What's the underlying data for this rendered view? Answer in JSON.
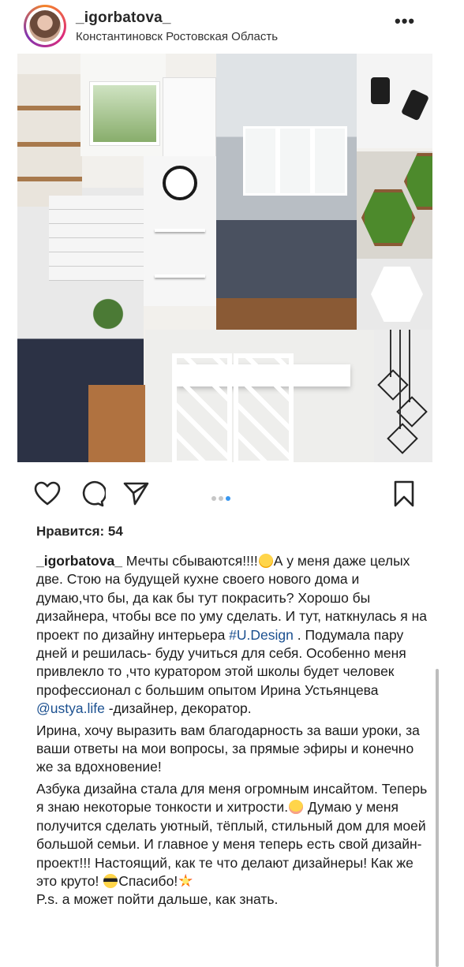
{
  "header": {
    "username": "_igorbatova_",
    "location": "Константиновск Ростовская Область",
    "more_icon": "more-dots-icon"
  },
  "post_image": {
    "description_icon": "kitchen-moodboard-collage"
  },
  "actions": {
    "like_icon": "heart-icon",
    "comment_icon": "comment-icon",
    "share_icon": "paper-plane-icon",
    "save_icon": "bookmark-icon",
    "carousel_count": 3,
    "carousel_active_index": 2,
    "accent_color": "#3897f0"
  },
  "likes": {
    "text": "Нравится: 54"
  },
  "caption": {
    "username": "_igorbatova_",
    "p1_a": " Мечты сбываются!!!!",
    "p1_b": "А у меня даже целых две. Стою на будущей кухне своего нового дома и думаю,что бы, да как бы тут покрасить? Хорошо бы дизайнера, чтобы  все по уму сделать. И тут, наткнулась я на проект по дизайну интерьера ",
    "hashtag": "#U.Design",
    "p1_c": " . Подумала пару дней и решилась- буду учиться для себя. Особенно меня привлекло то ,что куратором этой школы будет человек профессионал с большим опытом Ирина Устьянцева ",
    "mention": "@ustya.life",
    "p1_d": " -дизайнер, декоратор.",
    "p2": "Ирина, хочу выразить вам благодарность за ваши уроки, за ваши ответы на мои вопросы, за прямые эфиры и конечно же за вдохновение!",
    "p3_a": "Азбука дизайна стала для меня огромным инсайтом. Теперь я знаю некоторые тонкости и хитрости.",
    "p3_b": " Думаю у меня получится сделать уютный, тёплый, стильный дом для моей большой семьи. И главное у меня теперь есть свой дизайн-проект!!! Настоящий, как те что делают дизайнеры! Как же это круто! ",
    "p3_c": "Спасибо!",
    "p4": "P.s. а может пойти дальше, как знать."
  }
}
